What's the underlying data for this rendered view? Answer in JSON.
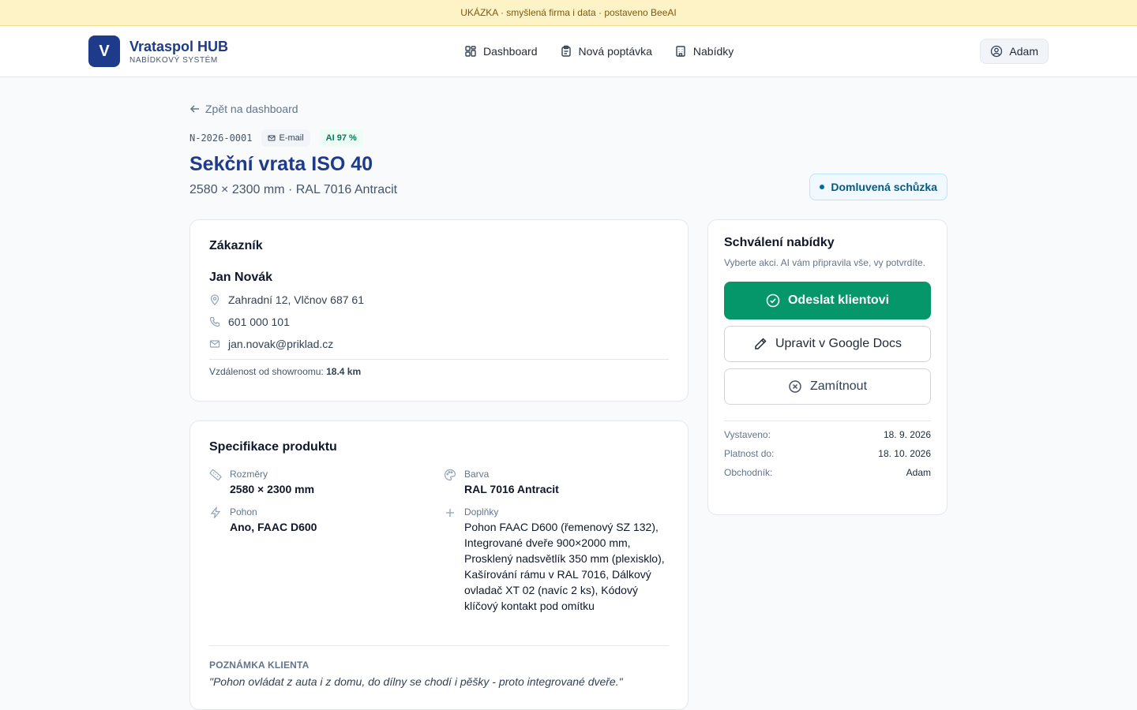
{
  "banner": {
    "text": "UKÁZKA · smyšlená firma i data · postaveno BeeAI"
  },
  "brand": {
    "logo_letter": "V",
    "name": "Vrataspol HUB",
    "subtitle": "NABÍDKOVÝ SYSTÉM",
    "color": "#1e3a8a"
  },
  "nav": {
    "items": [
      {
        "label": "Dashboard",
        "icon": "dashboard-icon"
      },
      {
        "label": "Nová poptávka",
        "icon": "clipboard-icon"
      },
      {
        "label": "Nabídky",
        "icon": "building-icon"
      }
    ]
  },
  "user": {
    "name": "Adam",
    "icon": "user-circle-icon"
  },
  "page": {
    "back_label": "Zpět na dashboard",
    "ref": "N-2026-0001",
    "source_chip": "E-mail",
    "ai_chip": "AI 97 %",
    "title": "Sekční vrata ISO 40",
    "subtitle": "2580 × 2300 mm · RAL 7016 Antracit",
    "status": "Domluvená schůzka"
  },
  "customer": {
    "card_title": "Zákazník",
    "name": "Jan Novák",
    "address": "Zahradní 12, Vlčnov 687 61",
    "phone": "601 000 101",
    "email": "jan.novak@priklad.cz",
    "distance_label": "Vzdálenost od showroomu:",
    "distance_value": "18.4 km"
  },
  "spec": {
    "card_title": "Specifikace produktu",
    "dimensions_label": "Rozměry",
    "dimensions_value": "2580 × 2300 mm",
    "color_label": "Barva",
    "color_value": "RAL 7016 Antracit",
    "drive_label": "Pohon",
    "drive_value": "Ano, FAAC D600",
    "extras_label": "Doplňky",
    "extras_value": "Pohon FAAC D600 (řemenový SZ 132), Integrované dveře 900×2000 mm, Prosklený nadsvětlík 350 mm (plexisklo), Kašírování rámu v RAL 7016, Dálkový ovladač XT 02 (navíc 2 ks), Kódový klíčový kontakt pod omítku",
    "note_label": "POZNÁMKA KLIENTA",
    "note_text": "\"Pohon ovládat z auta i z domu, do dílny se chodí i pěšky - proto integrované dveře.\""
  },
  "approval": {
    "card_title": "Schválení nabídky",
    "subtitle": "Vyberte akci. AI vám připravila vše, vy potvrdíte.",
    "send_label": "Odeslat klientovi",
    "edit_label": "Upravit v Google Docs",
    "reject_label": "Zamítnout",
    "issued_label": "Vystaveno:",
    "issued_value": "18. 9. 2026",
    "valid_label": "Platnost do:",
    "valid_value": "18. 10. 2026",
    "dealer_label": "Obchodník:",
    "dealer_value": "Adam",
    "primary_color": "#059669"
  }
}
